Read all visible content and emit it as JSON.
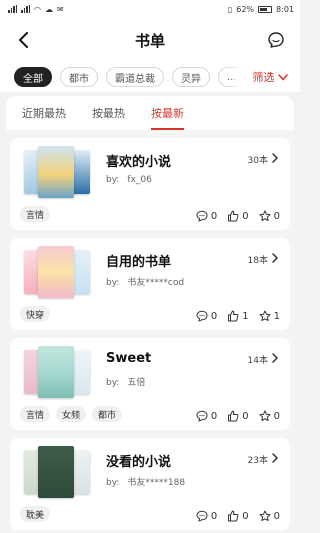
{
  "status_bar": {
    "left_icons": [
      "sim-icon",
      "sim-icon",
      "wifi-icon",
      "data-icon",
      "cloud-icon",
      "mail-icon",
      "app-icon"
    ],
    "battery": "62%",
    "time": "8:01"
  },
  "header": {
    "title": "书单"
  },
  "categories": {
    "items": [
      "全部",
      "都市",
      "霸道总裁",
      "灵异",
      "..."
    ],
    "active_index": 0,
    "filter_label": "筛选"
  },
  "tabs": {
    "items": [
      "近期最热",
      "按最热",
      "按最新"
    ],
    "active_index": 2
  },
  "accent": "#d9352d",
  "lists": [
    {
      "name": "喜欢的小说",
      "count": "30本",
      "by_label": "by:",
      "author": "fx_06",
      "tags": [
        "言情"
      ],
      "comments": "0",
      "likes": "0",
      "stars": "0",
      "cover_colors": [
        "#cfe3f2",
        "#f3d27a",
        "#9ac3e0"
      ]
    },
    {
      "name": "自用的书单",
      "count": "18本",
      "by_label": "by:",
      "author": "书友*****cod",
      "tags": [
        "快穿"
      ],
      "comments": "0",
      "likes": "1",
      "stars": "1",
      "cover_colors": [
        "#f7c9d2",
        "#fbe3a8",
        "#c7e0f1"
      ]
    },
    {
      "name": "Sweet",
      "count": "14本",
      "by_label": "by:",
      "author": "五倍",
      "tags": [
        "言情",
        "女频",
        "都市"
      ],
      "comments": "0",
      "likes": "0",
      "stars": "0",
      "cover_colors": [
        "#e7b8c8",
        "#a7d8cf",
        "#d7e8ef"
      ]
    },
    {
      "name": "没看的小说",
      "count": "23本",
      "by_label": "by:",
      "author": "书友*****188",
      "tags": [
        "耽美"
      ],
      "comments": "0",
      "likes": "0",
      "stars": "0",
      "cover_colors": [
        "#c9d7c4",
        "#2f4a3a",
        "#d9e1e4"
      ]
    }
  ]
}
